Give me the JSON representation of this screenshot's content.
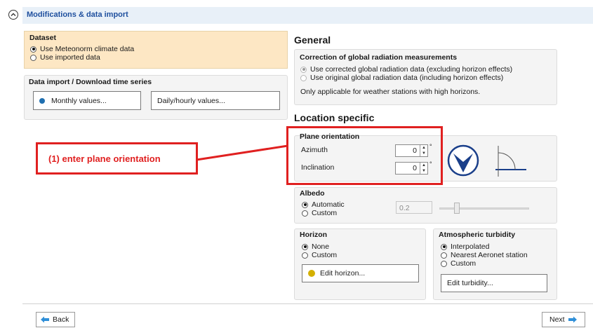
{
  "header": {
    "title": "Modifications & data import"
  },
  "dataset": {
    "title": "Dataset",
    "options": [
      "Use Meteonorm climate data",
      "Use imported data"
    ]
  },
  "data_import": {
    "title": "Data import / Download time series",
    "monthly_label": "Monthly values...",
    "daily_label": "Daily/hourly values..."
  },
  "general": {
    "title": "General",
    "correction_title": "Correction of global radiation measurements",
    "options": [
      "Use corrected global radiation data (excluding horizon effects)",
      "Use original global radiation data (including horizon effects)"
    ],
    "note": "Only applicable for weather stations with high horizons."
  },
  "location": {
    "title": "Location specific",
    "plane_title": "Plane orientation",
    "azimuth_label": "Azimuth",
    "azimuth_value": "0",
    "inclination_label": "Inclination",
    "inclination_value": "0",
    "degree_symbol": "°"
  },
  "annotation": {
    "text": "(1) enter plane orientation"
  },
  "albedo": {
    "title": "Albedo",
    "options": [
      "Automatic",
      "Custom"
    ],
    "value": "0.2"
  },
  "horizon": {
    "title": "Horizon",
    "options": [
      "None",
      "Custom"
    ],
    "edit_label": "Edit horizon..."
  },
  "turbidity": {
    "title": "Atmospheric turbidity",
    "options": [
      "Interpolated",
      "Nearest Aeronet station",
      "Custom"
    ],
    "edit_label": "Edit turbidity..."
  },
  "footer": {
    "back_label": "Back",
    "next_label": "Next"
  },
  "colors": {
    "accent": "#1e4f9e",
    "dataset_bg": "#fde7c4",
    "annotation": "#e02020",
    "horizon_icon": "#d4b000"
  }
}
